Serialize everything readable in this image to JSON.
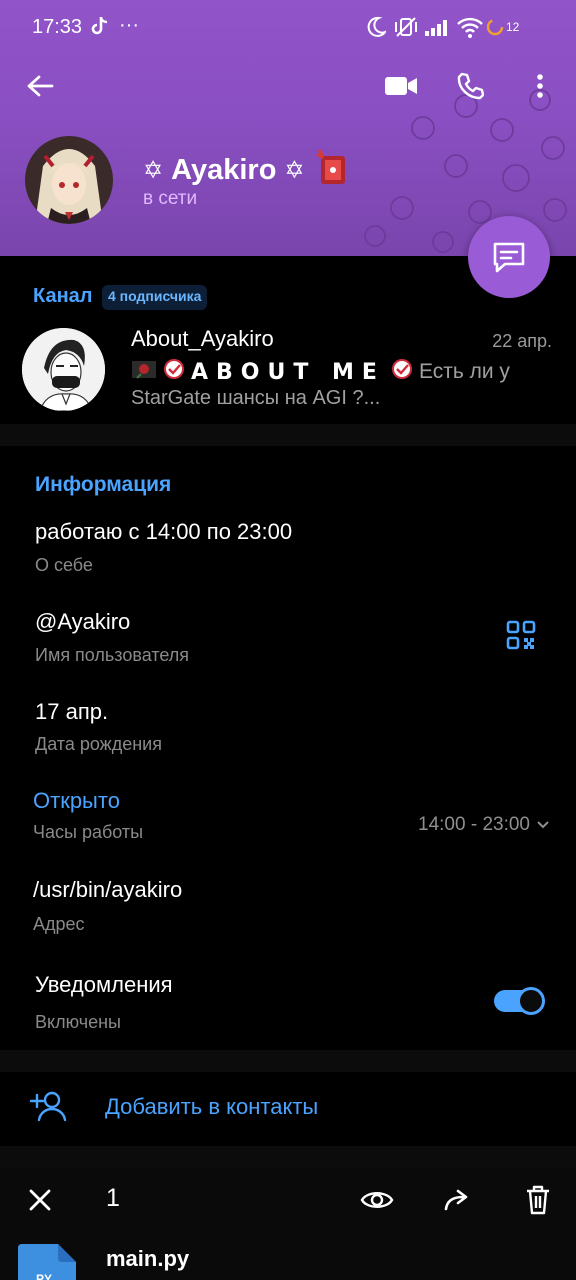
{
  "statusbar": {
    "time": "17:33",
    "more": "···",
    "battery": "12"
  },
  "profile": {
    "name": "Ayakiro",
    "name_prefix": "✡",
    "name_suffix": "✡",
    "status": "в сети"
  },
  "channel": {
    "section_label": "Канал",
    "subscribers": "4 подписчика",
    "name": "About_Ayakiro",
    "date": "22 апр.",
    "preview_title": "ABOUT ME",
    "preview_tail": "Есть ли у",
    "preview_line2": "StarGate шансы на AGI ?..."
  },
  "info": {
    "title": "Информация",
    "bio": {
      "value": "работаю с 14:00 по 23:00",
      "label": "О себе"
    },
    "username": {
      "value": "@Ayakiro",
      "label": "Имя пользователя"
    },
    "birthday": {
      "value": "17 апр.",
      "label": "Дата рождения"
    },
    "hours": {
      "status": "Открыто",
      "label": "Часы работы",
      "range": "14:00 - 23:00"
    },
    "address": {
      "value": "/usr/bin/ayakiro",
      "label": "Адрес"
    },
    "notifications": {
      "value": "Уведомления",
      "label": "Включены",
      "enabled": true
    }
  },
  "actions": {
    "add_contact": "Добавить в контакты"
  },
  "selection": {
    "count": "1",
    "file_name": "main.py",
    "file_ext": "PY"
  },
  "colors": {
    "header": "#8a4fc2",
    "accent": "#4aa3ff",
    "fab": "#9a5bd6",
    "online": "#e2b8ff"
  }
}
